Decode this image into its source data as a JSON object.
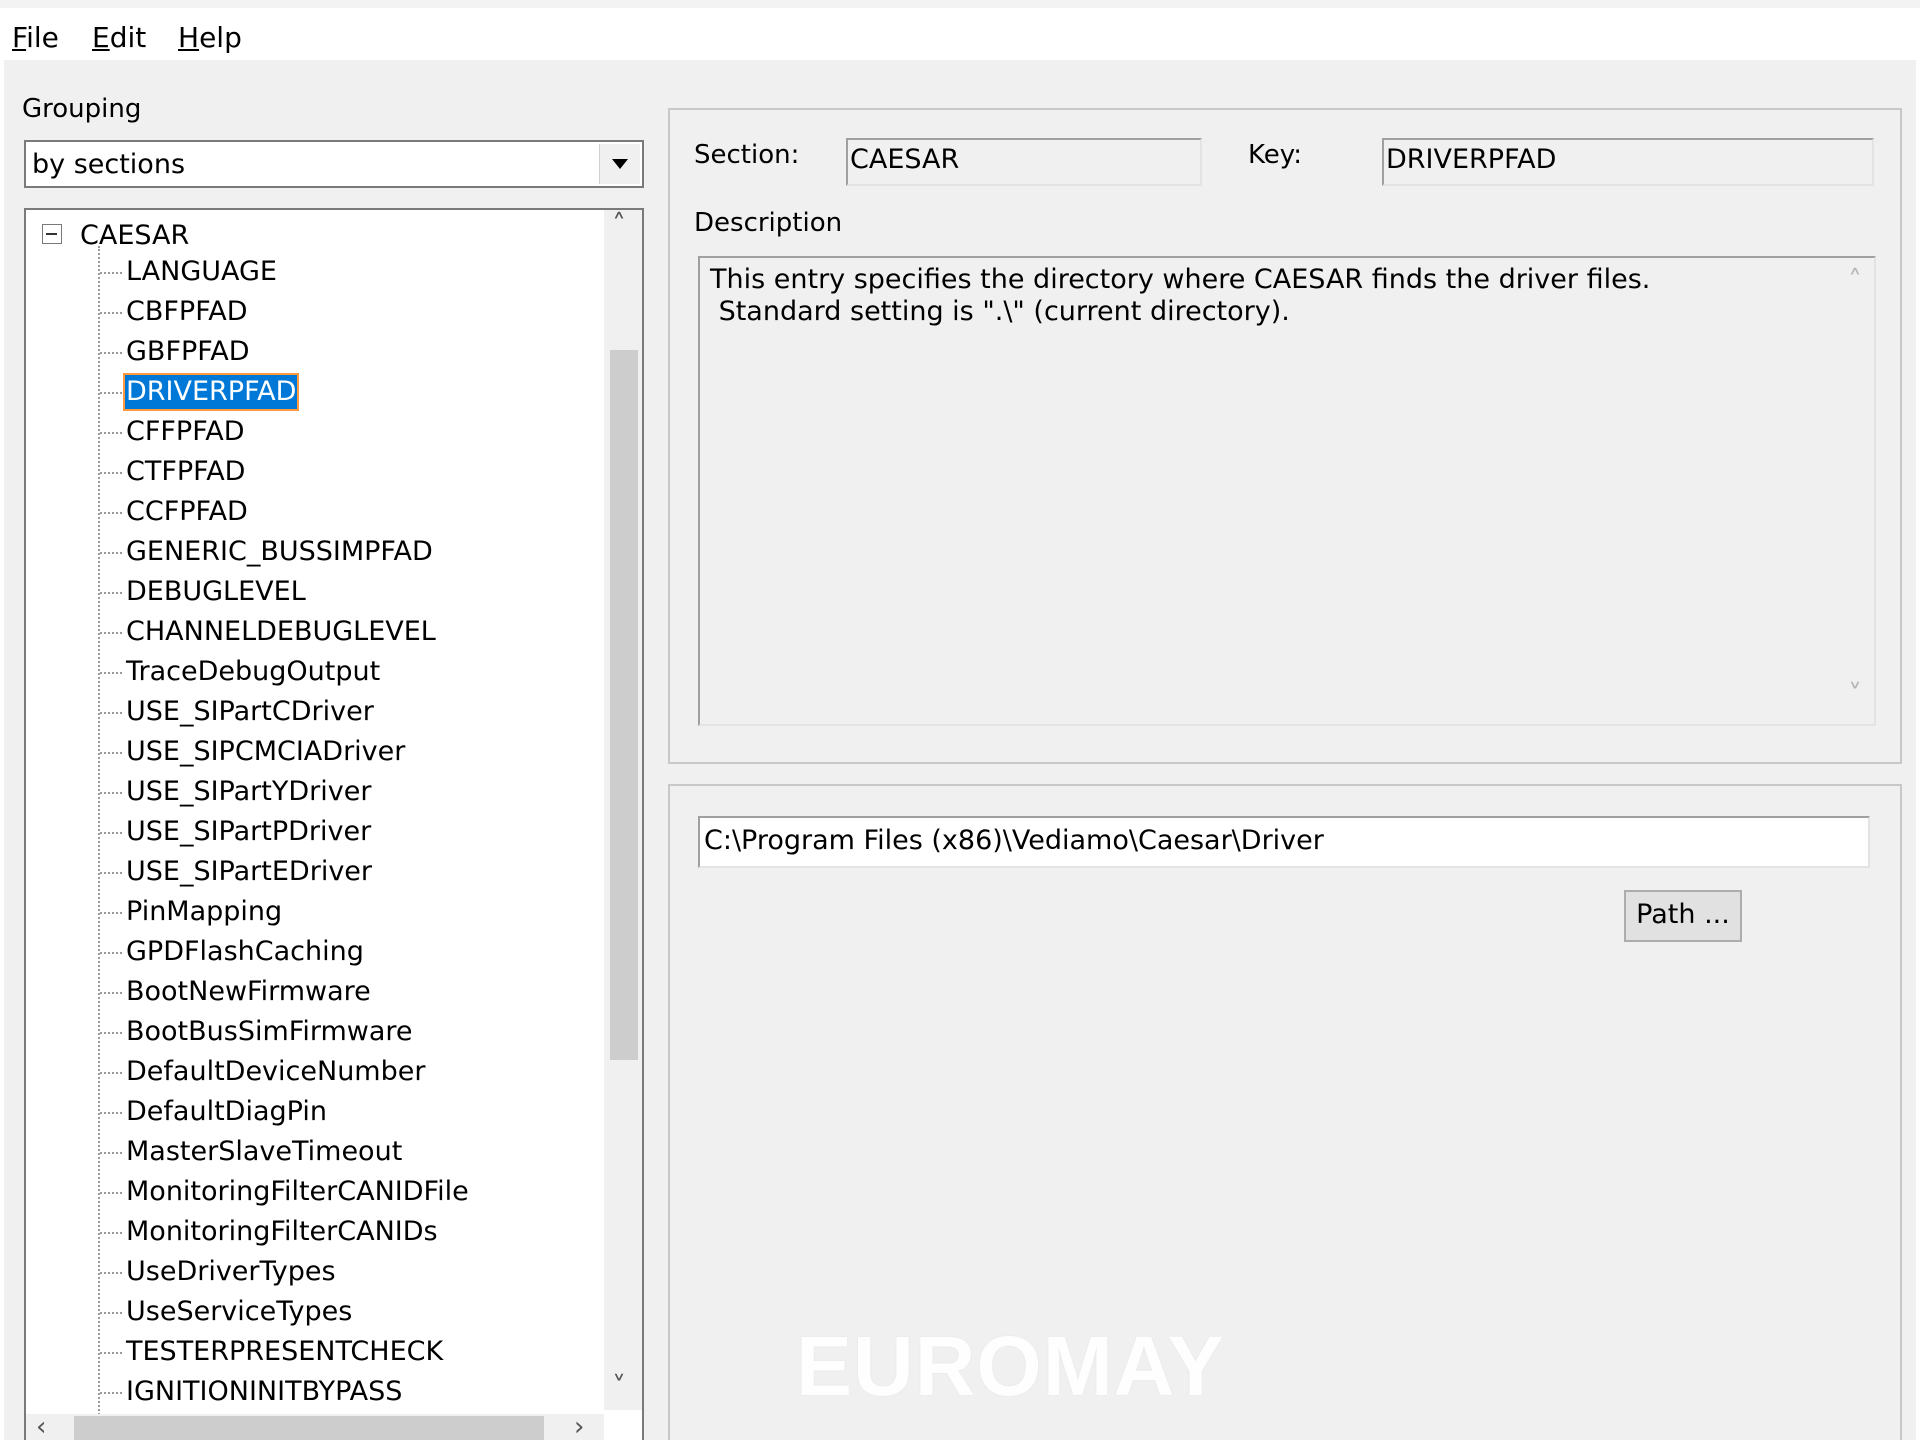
{
  "menu": {
    "file": {
      "accel": "F",
      "rest": "ile"
    },
    "edit": {
      "accel": "E",
      "rest": "dit"
    },
    "help": {
      "accel": "H",
      "rest": "elp"
    }
  },
  "grouping": {
    "label": "Grouping",
    "selected": "by sections"
  },
  "tree": {
    "root": "CAESAR",
    "items": [
      "LANGUAGE",
      "CBFPFAD",
      "GBFPFAD",
      "DRIVERPFAD",
      "CFFPFAD",
      "CTFPFAD",
      "CCFPFAD",
      "GENERIC_BUSSIMPFAD",
      "DEBUGLEVEL",
      "CHANNELDEBUGLEVEL",
      "TraceDebugOutput",
      "USE_SIPartCDriver",
      "USE_SIPCMCIADriver",
      "USE_SIPartYDriver",
      "USE_SIPartPDriver",
      "USE_SIPartEDriver",
      "PinMapping",
      "GPDFlashCaching",
      "BootNewFirmware",
      "BootBusSimFirmware",
      "DefaultDeviceNumber",
      "DefaultDiagPin",
      "MasterSlaveTimeout",
      "MonitoringFilterCANIDFile",
      "MonitoringFilterCANIDs",
      "UseDriverTypes",
      "UseServiceTypes",
      "TESTERPRESENTCHECK",
      "IGNITIONINITBYPASS"
    ],
    "selected_index": 3
  },
  "details": {
    "section_label": "Section:",
    "section_value": "CAESAR",
    "key_label": "Key:",
    "key_value": "DRIVERPFAD",
    "description_label": "Description",
    "description_line1": "This entry specifies the directory where CAESAR finds the driver files.",
    "description_line2": " Standard setting is \".\\\" (current directory)."
  },
  "value": {
    "path": "C:\\Program Files (x86)\\Vediamo\\Caesar\\Driver",
    "path_button": "Path ..."
  },
  "watermark": "EUROMAY"
}
